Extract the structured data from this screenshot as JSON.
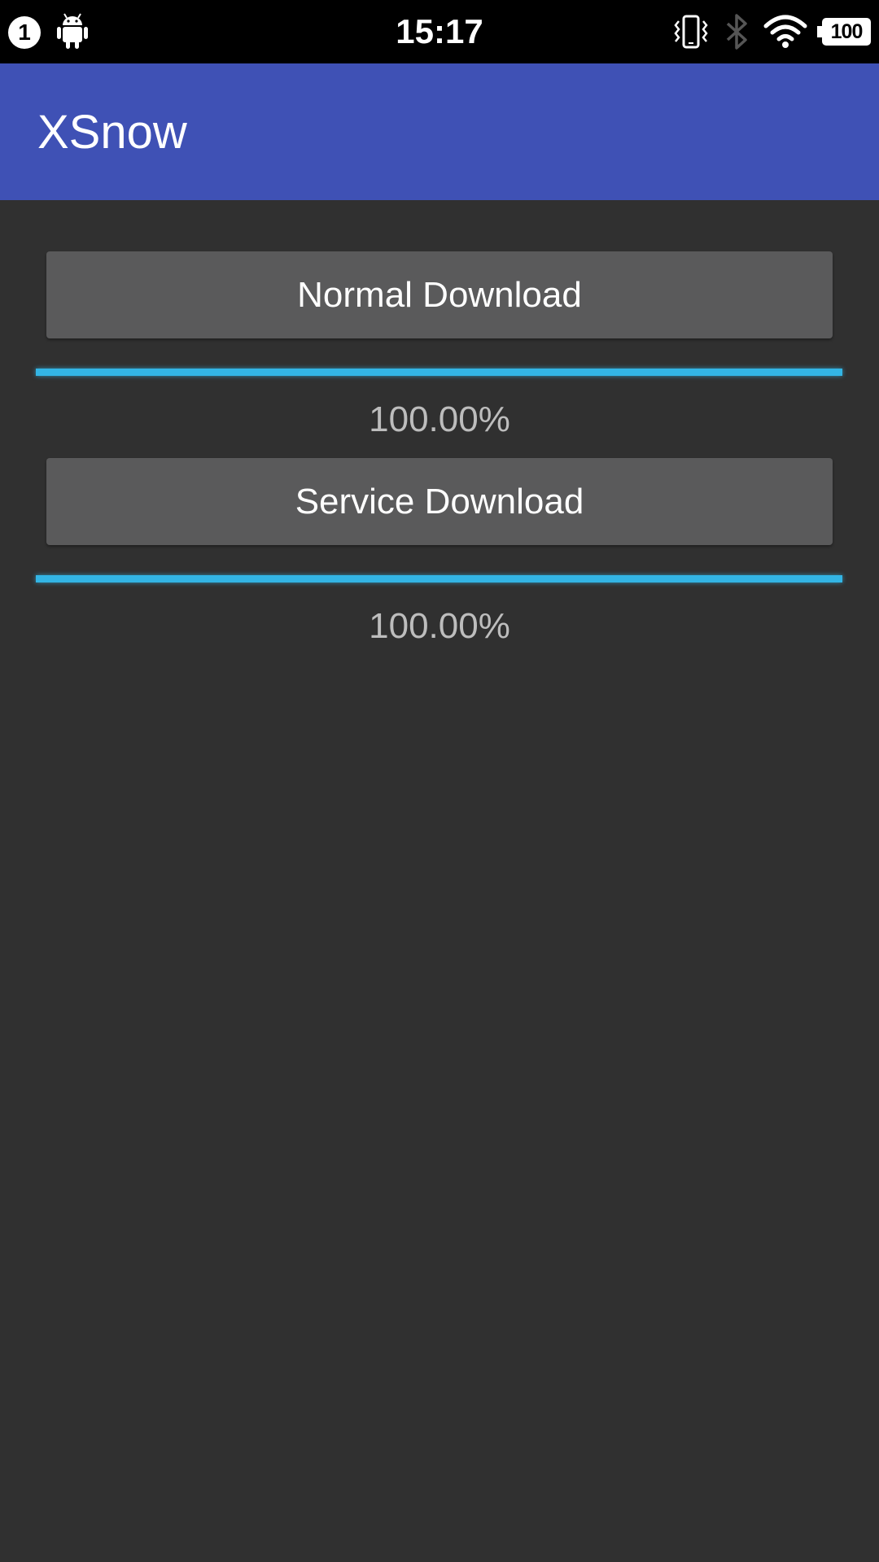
{
  "status_bar": {
    "notification_count": "1",
    "time": "15:17",
    "battery_level": "100",
    "icons": [
      "notification-badge-icon",
      "android-icon",
      "vibrate-icon",
      "bluetooth-icon",
      "wifi-icon",
      "battery-icon"
    ]
  },
  "app_bar": {
    "title": "XSnow",
    "color": "#3f51b5"
  },
  "downloads": [
    {
      "button_label": "Normal Download",
      "progress_fraction": 1.0,
      "progress_text": "100.00%"
    },
    {
      "button_label": "Service Download",
      "progress_fraction": 1.0,
      "progress_text": "100.00%"
    }
  ],
  "colors": {
    "background": "#303030",
    "progress": "#33b5e5",
    "button": "#5a5a5b"
  }
}
